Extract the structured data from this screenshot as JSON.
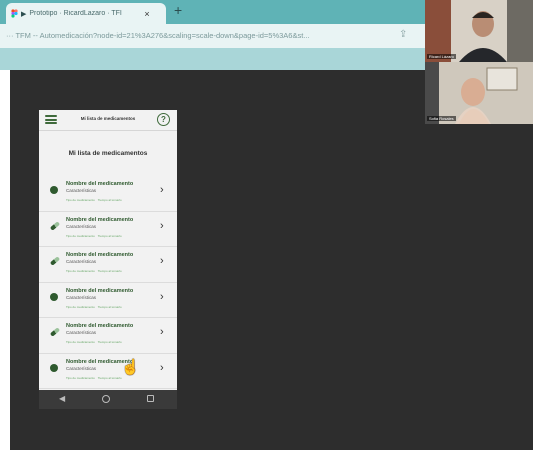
{
  "browser": {
    "tab": {
      "title": "Prototipo · RicardLazaro · TFI",
      "close": "×"
    },
    "new_tab": "+",
    "url": "··· TFM -- Automedicación?node-id=21%3A276&scaling=scale-down&page-id=5%3A6&st..."
  },
  "call": {
    "participants": [
      {
        "name": "Ricard Lázaro"
      },
      {
        "name": "Sofia Rosales"
      }
    ]
  },
  "app": {
    "header_title": "Mi lista de medicamentos",
    "help": "?",
    "page_title": "Mi lista de medicamentos",
    "items": [
      {
        "name": "Nombre del medicamento",
        "sub": "Características",
        "tag1": "Tipo de medicamento",
        "tag2": "Tiempo al tomarlo",
        "icon": "pill-round-icon"
      },
      {
        "name": "Nombre del medicamento",
        "sub": "Características",
        "tag1": "Tipo de medicamento",
        "tag2": "Tiempo al tomarlo",
        "icon": "capsule-icon"
      },
      {
        "name": "Nombre del medicamento",
        "sub": "Características",
        "tag1": "Tipo de medicamento",
        "tag2": "Tiempo al tomarlo",
        "icon": "capsule-icon"
      },
      {
        "name": "Nombre del medicamento",
        "sub": "Características",
        "tag1": "Tipo de medicamento",
        "tag2": "Tiempo al tomarlo",
        "icon": "pill-round-icon"
      },
      {
        "name": "Nombre del medicamento",
        "sub": "Características",
        "tag1": "Tipo de medicamento",
        "tag2": "Tiempo al tomarlo",
        "icon": "capsule-icon"
      },
      {
        "name": "Nombre del medicamento",
        "sub": "Características",
        "tag1": "Tipo de medicamento",
        "tag2": "Tiempo al tomarlo",
        "icon": "pill-round-icon"
      }
    ]
  }
}
